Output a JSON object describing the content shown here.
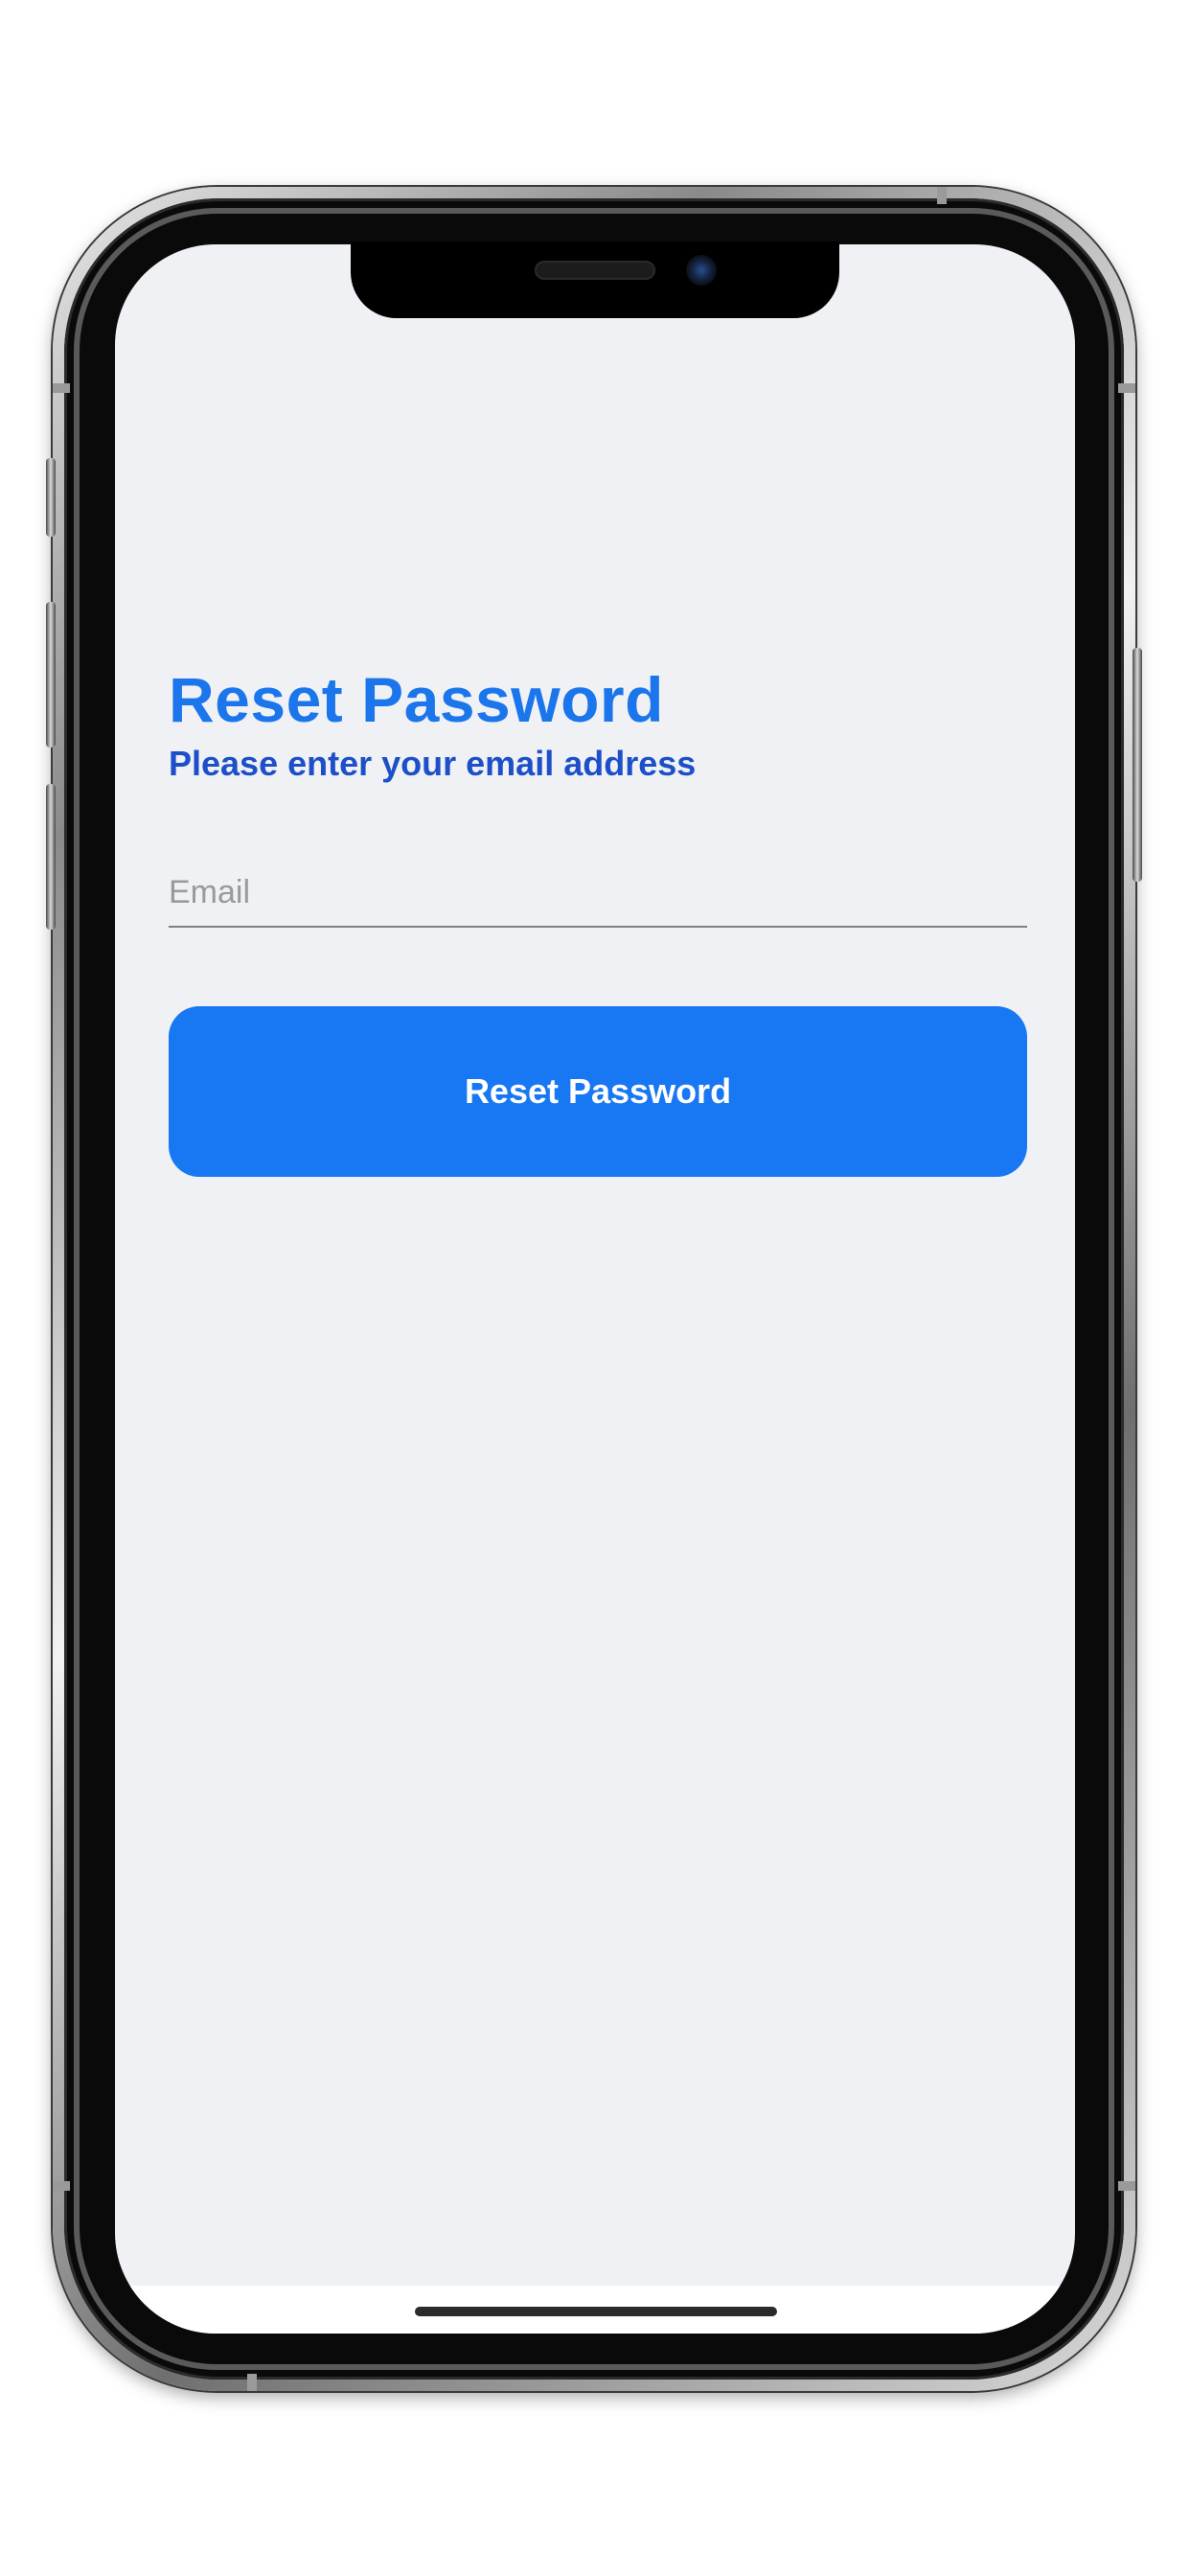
{
  "screen": {
    "title": "Reset Password",
    "subtitle": "Please enter your email address",
    "email_field": {
      "placeholder": "Email",
      "value": ""
    },
    "submit_label": "Reset Password"
  },
  "colors": {
    "accent": "#1877f2",
    "title": "#1b76ec",
    "subtitle": "#1d4fc9",
    "background": "#eff1f5"
  }
}
